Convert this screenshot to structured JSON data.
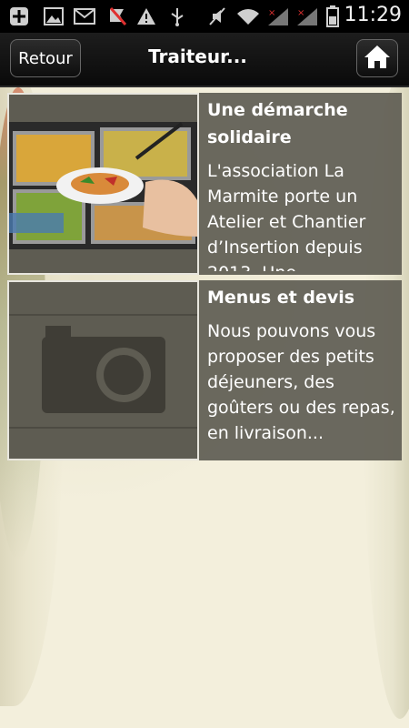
{
  "status_bar": {
    "time": "11:29",
    "icons": [
      "add-box-icon",
      "image-icon",
      "gmail-icon",
      "flag-icon",
      "warning-icon",
      "usb-icon",
      "muted-icon",
      "wifi-icon",
      "signal-x-icon",
      "signal-x-icon",
      "battery-icon"
    ]
  },
  "nav": {
    "back_label": "Retour",
    "title": "Traiteur...",
    "home_icon": "home-icon"
  },
  "items": [
    {
      "title": "Une démarche solidaire",
      "description": "L'association La Marmite porte un Atelier et Chantier d’Insertion depuis 2013. Une...",
      "thumbnail": "food-buffet-photo"
    },
    {
      "title": "Menus et devis",
      "description": "Nous pouvons vous proposer des petits déjeuners, des goûters ou des repas, en livraison...",
      "thumbnail": "camera-placeholder-icon"
    }
  ],
  "colors": {
    "statusbar_bg": "#000000",
    "navbar_bg": "#111111",
    "row_bg": "#5e5c52",
    "page_bg": "#f3efdc"
  }
}
